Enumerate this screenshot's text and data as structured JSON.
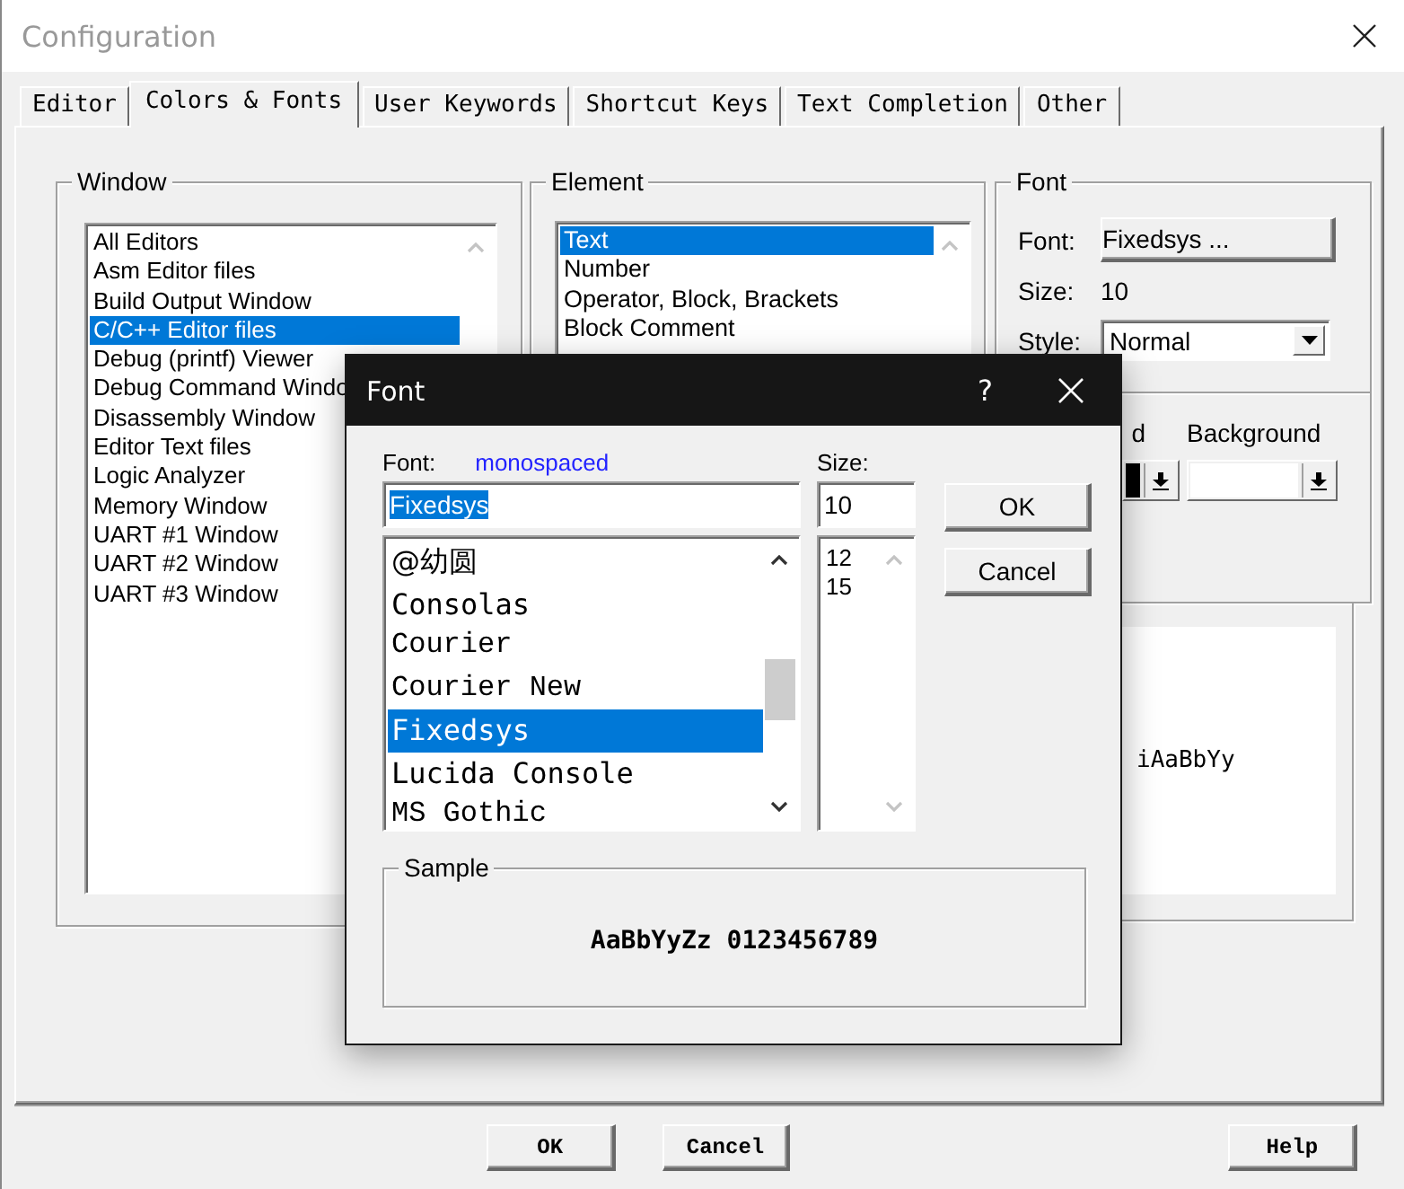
{
  "window": {
    "title": "Configuration"
  },
  "tabs": [
    {
      "label": "Editor",
      "selected": false
    },
    {
      "label": "Colors & Fonts",
      "selected": true
    },
    {
      "label": "User Keywords",
      "selected": false
    },
    {
      "label": "Shortcut Keys",
      "selected": false
    },
    {
      "label": "Text Completion",
      "selected": false
    },
    {
      "label": "Other",
      "selected": false
    }
  ],
  "window_group": {
    "label": "Window",
    "scrollbar_enabled": false,
    "items": [
      {
        "label": "All Editors",
        "selected": false
      },
      {
        "label": "Asm Editor files",
        "selected": false
      },
      {
        "label": "Build Output Window",
        "selected": false
      },
      {
        "label": "C/C++ Editor files",
        "selected": true
      },
      {
        "label": "Debug (printf) Viewer",
        "selected": false
      },
      {
        "label": "Debug Command Windo",
        "selected": false
      },
      {
        "label": "Disassembly Window",
        "selected": false
      },
      {
        "label": "Editor Text files",
        "selected": false
      },
      {
        "label": "Logic Analyzer",
        "selected": false
      },
      {
        "label": "Memory Window",
        "selected": false
      },
      {
        "label": "UART #1 Window",
        "selected": false
      },
      {
        "label": "UART #2 Window",
        "selected": false
      },
      {
        "label": "UART #3 Window",
        "selected": false
      }
    ]
  },
  "element_group": {
    "label": "Element",
    "scrollbar_enabled": false,
    "items": [
      {
        "label": "Text",
        "selected": true
      },
      {
        "label": "Number",
        "selected": false
      },
      {
        "label": "Operator, Block, Brackets",
        "selected": false
      },
      {
        "label": "Block Comment",
        "selected": false
      }
    ]
  },
  "font_group": {
    "label": "Font",
    "font_label": "Font:",
    "font_button": "Fixedsys ...",
    "size_label": "Size:",
    "size_value": "10",
    "style_label": "Style:",
    "style_value": "Normal"
  },
  "colors_group": {
    "foreground_label": "d",
    "background_label": "Background"
  },
  "preview": {
    "text": "iAaBbYy"
  },
  "buttons": [
    "OK",
    "Cancel",
    "Help"
  ],
  "font_dialog": {
    "title": "Font",
    "help": "?",
    "font_label": "Font:",
    "font_hint": "monospaced",
    "font_value": "Fixedsys",
    "value_selected": true,
    "size_label": "Size:",
    "size_value": "10",
    "ok": "OK",
    "cancel": "Cancel",
    "sample_label": "Sample",
    "sample_text": "AaBbYyZz 0123456789",
    "fonts_scrollbar_enabled": true,
    "fonts": [
      {
        "label": "@幼圆",
        "selected": false
      },
      {
        "label": "Consolas",
        "selected": false
      },
      {
        "label": "Courier",
        "selected": false
      },
      {
        "label": "Courier New",
        "selected": false
      },
      {
        "label": "Fixedsys",
        "selected": true
      },
      {
        "label": "Lucida Console",
        "selected": false
      },
      {
        "label": "MS Gothic",
        "selected": false
      }
    ],
    "sizes_scrollbar_enabled": false,
    "sizes": [
      {
        "label": "12",
        "selected": false
      },
      {
        "label": "15",
        "selected": false
      }
    ]
  }
}
